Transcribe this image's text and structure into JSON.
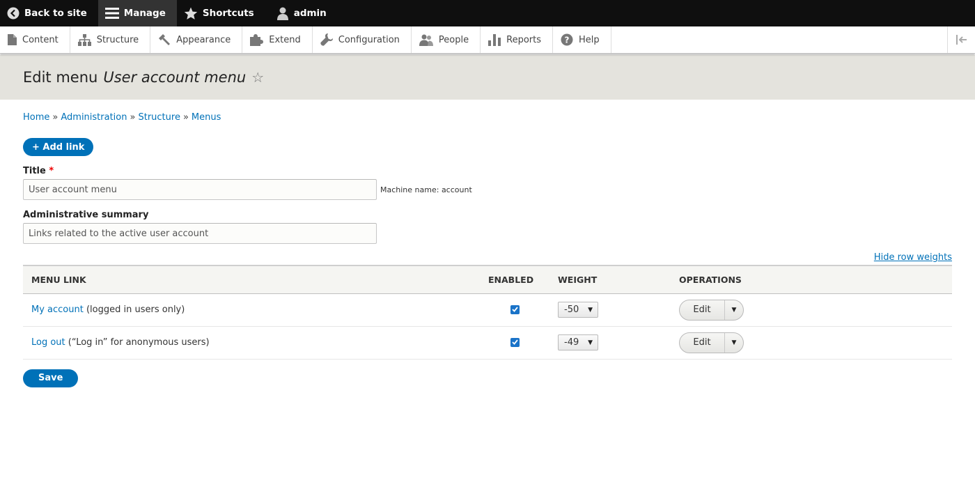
{
  "toolbar": {
    "back": "Back to site",
    "manage": "Manage",
    "shortcuts": "Shortcuts",
    "user": "admin"
  },
  "tray": {
    "items": [
      "Content",
      "Structure",
      "Appearance",
      "Extend",
      "Configuration",
      "People",
      "Reports",
      "Help"
    ]
  },
  "header": {
    "title_prefix": "Edit menu",
    "title_name": "User account menu",
    "star": "☆"
  },
  "breadcrumb": {
    "items": [
      "Home",
      "Administration",
      "Structure",
      "Menus"
    ],
    "separator": "»"
  },
  "add_link_label": "+ Add link",
  "form": {
    "title_label": "Title",
    "required_mark": "*",
    "title_value": "User account menu",
    "machine_name": "Machine name: account",
    "summary_label": "Administrative summary",
    "summary_value": "Links related to the active user account"
  },
  "row_weights_label": "Hide row weights",
  "table": {
    "headers": [
      "Menu link",
      "Enabled",
      "Weight",
      "Operations"
    ],
    "rows": [
      {
        "link": "My account",
        "note": "(logged in users only)",
        "enabled": true,
        "weight": "-50",
        "op": "Edit"
      },
      {
        "link": "Log out",
        "note": "(“Log in” for anonymous users)",
        "enabled": true,
        "weight": "-49",
        "op": "Edit"
      }
    ]
  },
  "save_label": "Save",
  "colors": {
    "link": "#0071b8",
    "primary_button": "#0071b8",
    "toolbar_bg": "#0f0f0f",
    "header_bg": "#e4e3dd"
  }
}
